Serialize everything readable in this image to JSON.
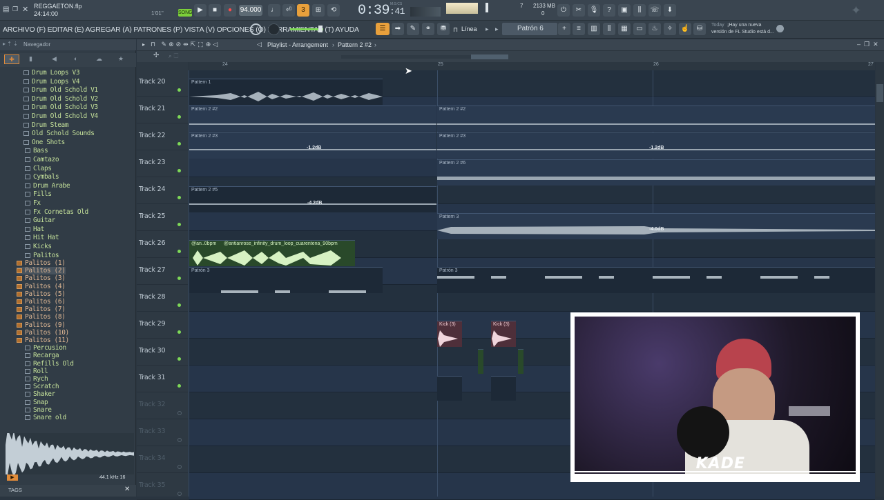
{
  "window": {
    "file_name": "REGGAETON.flp",
    "time_position": "24:14:00",
    "pattern_step": "1'01\""
  },
  "transport": {
    "song_label": "SONG",
    "tempo": "94.000",
    "clock_main": "0:39",
    "clock_sub": ":41",
    "mcs": "M:S:CS",
    "cpu": "7",
    "memory": "2133 MB",
    "voices": "0"
  },
  "menu": {
    "text": "ARCHIVO (F) EDITAR (E) AGREGAR (A) PATRONES (P) VISTA (V) OPCIONES (O) HERRAMIENTAS (T) AYUDA"
  },
  "toolbar": {
    "snap": "Línea",
    "pattern": "Patrón 6",
    "news_date": "Today",
    "news_text1": "¡Hay una nueva",
    "news_text2": "versión de FL Studio está d..."
  },
  "browser": {
    "title": "Navegador",
    "tags_label": "TAGS",
    "sample_info": "44.1 kHz 16",
    "items": [
      {
        "label": "Drum Loops V3",
        "color": "green"
      },
      {
        "label": "Drum Loops V4",
        "color": "green"
      },
      {
        "label": "Drum Old Schold V1",
        "color": "green"
      },
      {
        "label": "Drum Old Schold V2",
        "color": "green"
      },
      {
        "label": "Drum Old Schold V3",
        "color": "green"
      },
      {
        "label": "Drum Old Schold V4",
        "color": "green"
      },
      {
        "label": "Drum Steam",
        "color": "green"
      },
      {
        "label": "Old Schold Sounds",
        "color": "green"
      },
      {
        "label": "One Shots",
        "color": "green"
      },
      {
        "label": "Bass",
        "color": "green"
      },
      {
        "label": "Camtazo",
        "color": "green"
      },
      {
        "label": "Claps",
        "color": "green"
      },
      {
        "label": "Cymbals",
        "color": "green"
      },
      {
        "label": "Drum Arabe",
        "color": "green"
      },
      {
        "label": "Fills",
        "color": "green"
      },
      {
        "label": "Fx",
        "color": "green"
      },
      {
        "label": "Fx Cornetas Old",
        "color": "green"
      },
      {
        "label": "Guitar",
        "color": "green"
      },
      {
        "label": "Hat",
        "color": "green"
      },
      {
        "label": "Hit Hat",
        "color": "green"
      },
      {
        "label": "Kicks",
        "color": "green"
      },
      {
        "label": "Palitos",
        "color": "green"
      },
      {
        "label": "Palitos (1)",
        "color": "orange"
      },
      {
        "label": "Palitos (2)",
        "color": "orange"
      },
      {
        "label": "Palitos (3)",
        "color": "orange"
      },
      {
        "label": "Palitos (4)",
        "color": "orange"
      },
      {
        "label": "Palitos (5)",
        "color": "orange"
      },
      {
        "label": "Palitos (6)",
        "color": "orange"
      },
      {
        "label": "Palitos (7)",
        "color": "orange"
      },
      {
        "label": "Palitos (8)",
        "color": "orange"
      },
      {
        "label": "Palitos (9)",
        "color": "orange"
      },
      {
        "label": "Palitos (10)",
        "color": "orange"
      },
      {
        "label": "Palitos (11)",
        "color": "orange"
      },
      {
        "label": "Percusion",
        "color": "green"
      },
      {
        "label": "Recarga",
        "color": "green"
      },
      {
        "label": "Refills Old",
        "color": "green"
      },
      {
        "label": "Roll",
        "color": "green"
      },
      {
        "label": "Rych",
        "color": "green"
      },
      {
        "label": "Scratch",
        "color": "green"
      },
      {
        "label": "Shaker",
        "color": "green"
      },
      {
        "label": "Snap",
        "color": "green"
      },
      {
        "label": "Snare",
        "color": "green"
      },
      {
        "label": "Snare old",
        "color": "green"
      }
    ]
  },
  "playlist": {
    "title": "Playlist - Arrangement",
    "pattern": "Pattern 2 #2",
    "ruler": [
      "24",
      "25",
      "26",
      "27"
    ],
    "tracks": [
      "Track 20",
      "Track 21",
      "Track 22",
      "Track 23",
      "Track 24",
      "Track 25",
      "Track 26",
      "Track 27",
      "Track 28",
      "Track 29",
      "Track 30",
      "Track 31",
      "Track 32",
      "Track 33",
      "Track 34",
      "Track 35"
    ],
    "clips": {
      "p1": "Pattern 1",
      "p22a": "Pattern 2 #2",
      "p22b": "Pattern 2 #2",
      "p23a": "Pattern 2 #3",
      "p23b": "Pattern 2 #3",
      "p26": "Pattern 2 #6",
      "p25": "Pattern 2 #5",
      "p3": "Pattern 3",
      "loop1": "@an..0bpm",
      "loop2": "@antianrose_infinity_drum_loop_cuarentena_90bpm",
      "pat3a": "Patrón 3",
      "pat3b": "Patrón 3",
      "kick1": "Kick (3)",
      "kick2": "Kick (3)"
    },
    "db": {
      "a": "-1.2dB",
      "b": "-1.2dB",
      "c": "-4.2dB",
      "d": "-4.0dB"
    }
  },
  "webcam": {
    "overlay_text": "KADE"
  }
}
